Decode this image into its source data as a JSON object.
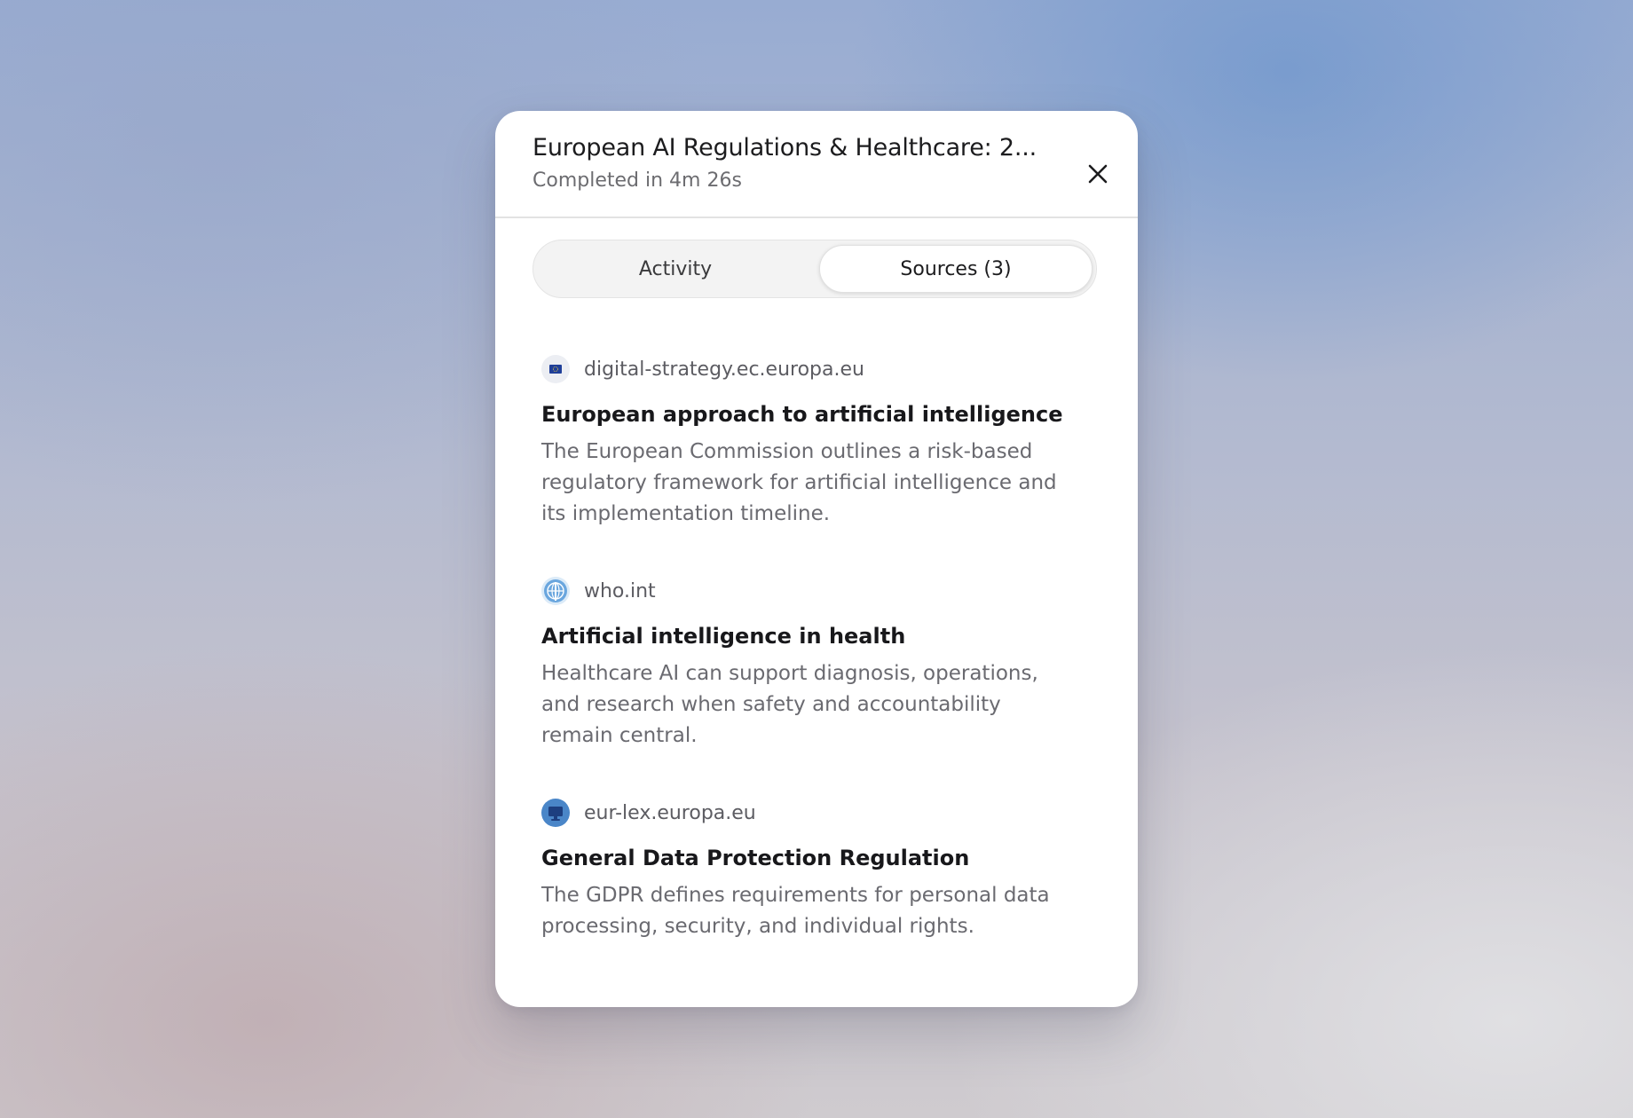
{
  "dialog": {
    "title": "European AI Regulations & Healthcare: 2...",
    "subtitle": "Completed in 4m 26s"
  },
  "tabs": [
    {
      "label": "Activity",
      "selected": false
    },
    {
      "label": "Sources (3)",
      "selected": true
    }
  ],
  "sources": [
    {
      "domain": "digital-strategy.ec.europa.eu",
      "icon": "eu-flag-icon",
      "title": "European approach to artificial intelligence",
      "description": "The European Commission outlines a risk-based regulatory framework for artificial intelligence and its implementation timeline."
    },
    {
      "domain": "who.int",
      "icon": "who-globe-icon",
      "title": "Artificial intelligence in health",
      "description": "Healthcare AI can support diagnosis, operations, and research when safety and accountability remain central."
    },
    {
      "domain": "eur-lex.europa.eu",
      "icon": "eur-lex-monitor-icon",
      "title": "General Data Protection Regulation",
      "description": "The GDPR defines requirements for personal data processing, security, and individual rights."
    }
  ],
  "colors": {
    "eu_blue": "#1f3f99",
    "who_blue": "#5b9bd5",
    "eurlex_blue": "#2c5aa0"
  }
}
